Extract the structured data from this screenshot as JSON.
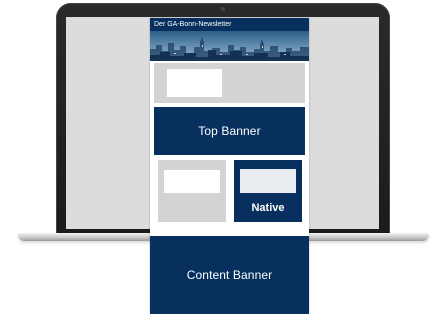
{
  "newsletter": {
    "title": "Der GA-Bonn-Newsletter",
    "top_banner_label": "Top Banner",
    "native_label": "Native",
    "content_banner_label": "Content Banner"
  },
  "icons": {
    "laptop": "laptop-icon",
    "skyline": "city-skyline-image"
  },
  "colors": {
    "brand_navy": "#07305f",
    "placeholder_grey": "#d3d3d3",
    "laptop_screen": "#dcdcdc"
  }
}
